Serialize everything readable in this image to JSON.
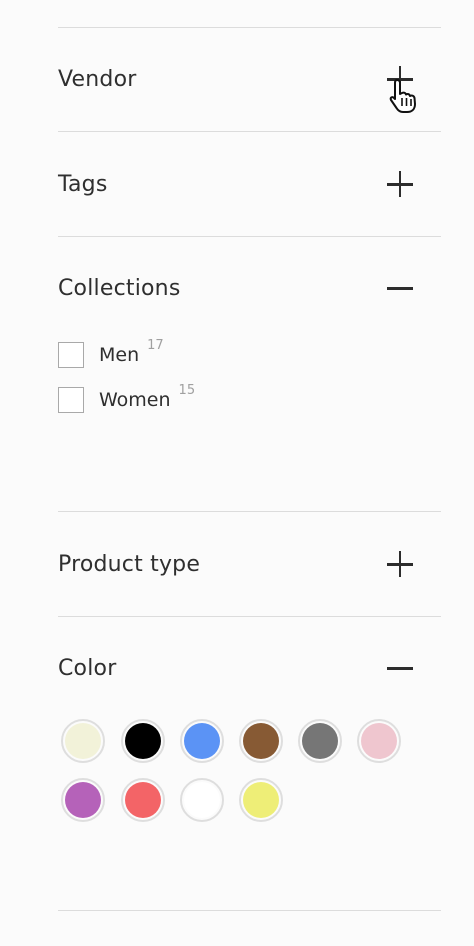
{
  "filters": {
    "vendor": {
      "title": "Vendor",
      "state": "collapsed",
      "icon": "plus-icon"
    },
    "tags": {
      "title": "Tags",
      "state": "collapsed",
      "icon": "plus-icon"
    },
    "collections": {
      "title": "Collections",
      "state": "expanded",
      "icon": "minus-icon",
      "options": [
        {
          "label": "Men",
          "count": "17"
        },
        {
          "label": "Women",
          "count": "15"
        }
      ]
    },
    "product_type": {
      "title": "Product type",
      "state": "collapsed",
      "icon": "plus-icon"
    },
    "color": {
      "title": "Color",
      "state": "expanded",
      "icon": "minus-icon",
      "swatches": [
        {
          "color": "#f2f2d9"
        },
        {
          "color": "#000000"
        },
        {
          "color": "#5b93f5"
        },
        {
          "color": "#875a34"
        },
        {
          "color": "#767676"
        },
        {
          "color": "#efc6cf"
        },
        {
          "color": "#b562b9"
        },
        {
          "color": "#f36467"
        },
        {
          "color": "#ffffff"
        },
        {
          "color": "#eeee77"
        }
      ]
    }
  },
  "cursor": {
    "icon": "hand-pointer-icon"
  }
}
